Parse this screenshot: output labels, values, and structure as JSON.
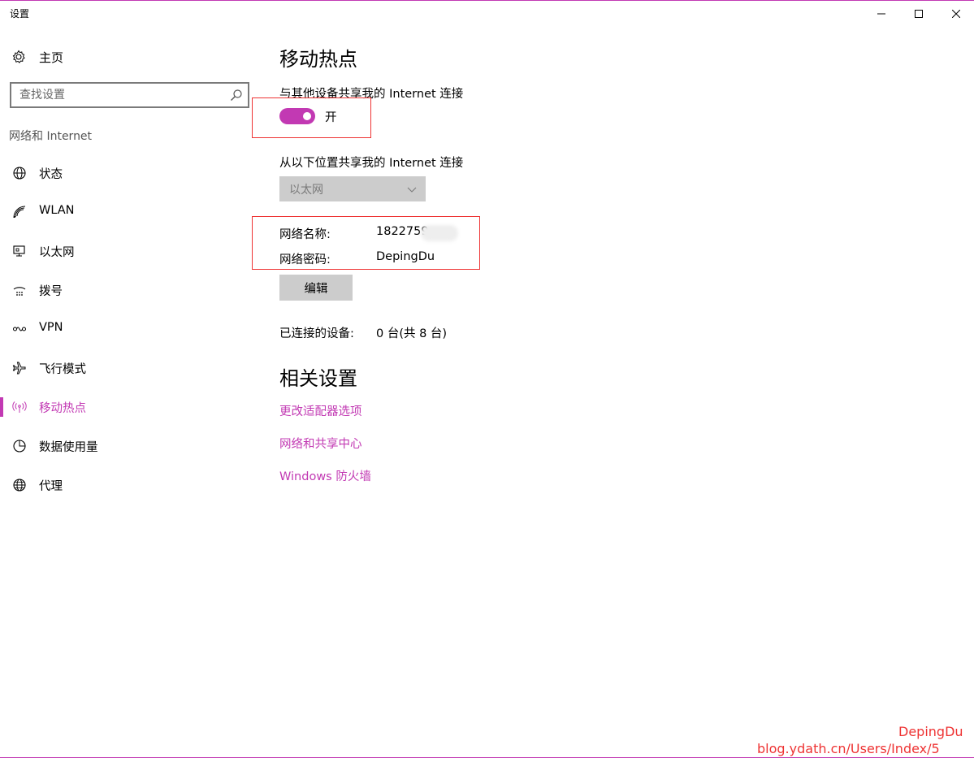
{
  "window": {
    "title": "设置"
  },
  "sidebar": {
    "home_label": "主页",
    "search_placeholder": "查找设置",
    "section_label": "网络和 Internet",
    "items": [
      {
        "label": "状态",
        "icon": "globe-status-icon"
      },
      {
        "label": "WLAN",
        "icon": "wifi-icon"
      },
      {
        "label": "以太网",
        "icon": "ethernet-icon"
      },
      {
        "label": "拨号",
        "icon": "dialup-icon"
      },
      {
        "label": "VPN",
        "icon": "vpn-icon"
      },
      {
        "label": "飞行模式",
        "icon": "airplane-icon"
      },
      {
        "label": "移动热点",
        "icon": "hotspot-icon",
        "active": true
      },
      {
        "label": "数据使用量",
        "icon": "data-usage-icon"
      },
      {
        "label": "代理",
        "icon": "globe-icon"
      }
    ]
  },
  "main": {
    "title": "移动热点",
    "share_label": "与其他设备共享我的 Internet 连接",
    "toggle_state": "开",
    "toggle_on": true,
    "share_from_label": "从以下位置共享我的 Internet 连接",
    "share_from_value": "以太网",
    "network_name_label": "网络名称:",
    "network_name_value": "1822759",
    "network_password_label": "网络密码:",
    "network_password_value": "DepingDu",
    "edit_button": "编辑",
    "connected_label": "已连接的设备:",
    "connected_value": "0 台(共 8 台)",
    "related_title": "相关设置",
    "links": [
      "更改适配器选项",
      "网络和共享中心",
      "Windows 防火墙"
    ]
  },
  "watermark": {
    "author": "DepingDu",
    "url": "blog.ydath.cn/Users/Index/5"
  },
  "colors": {
    "accent": "#c239b3",
    "annotation": "#ee3333"
  }
}
